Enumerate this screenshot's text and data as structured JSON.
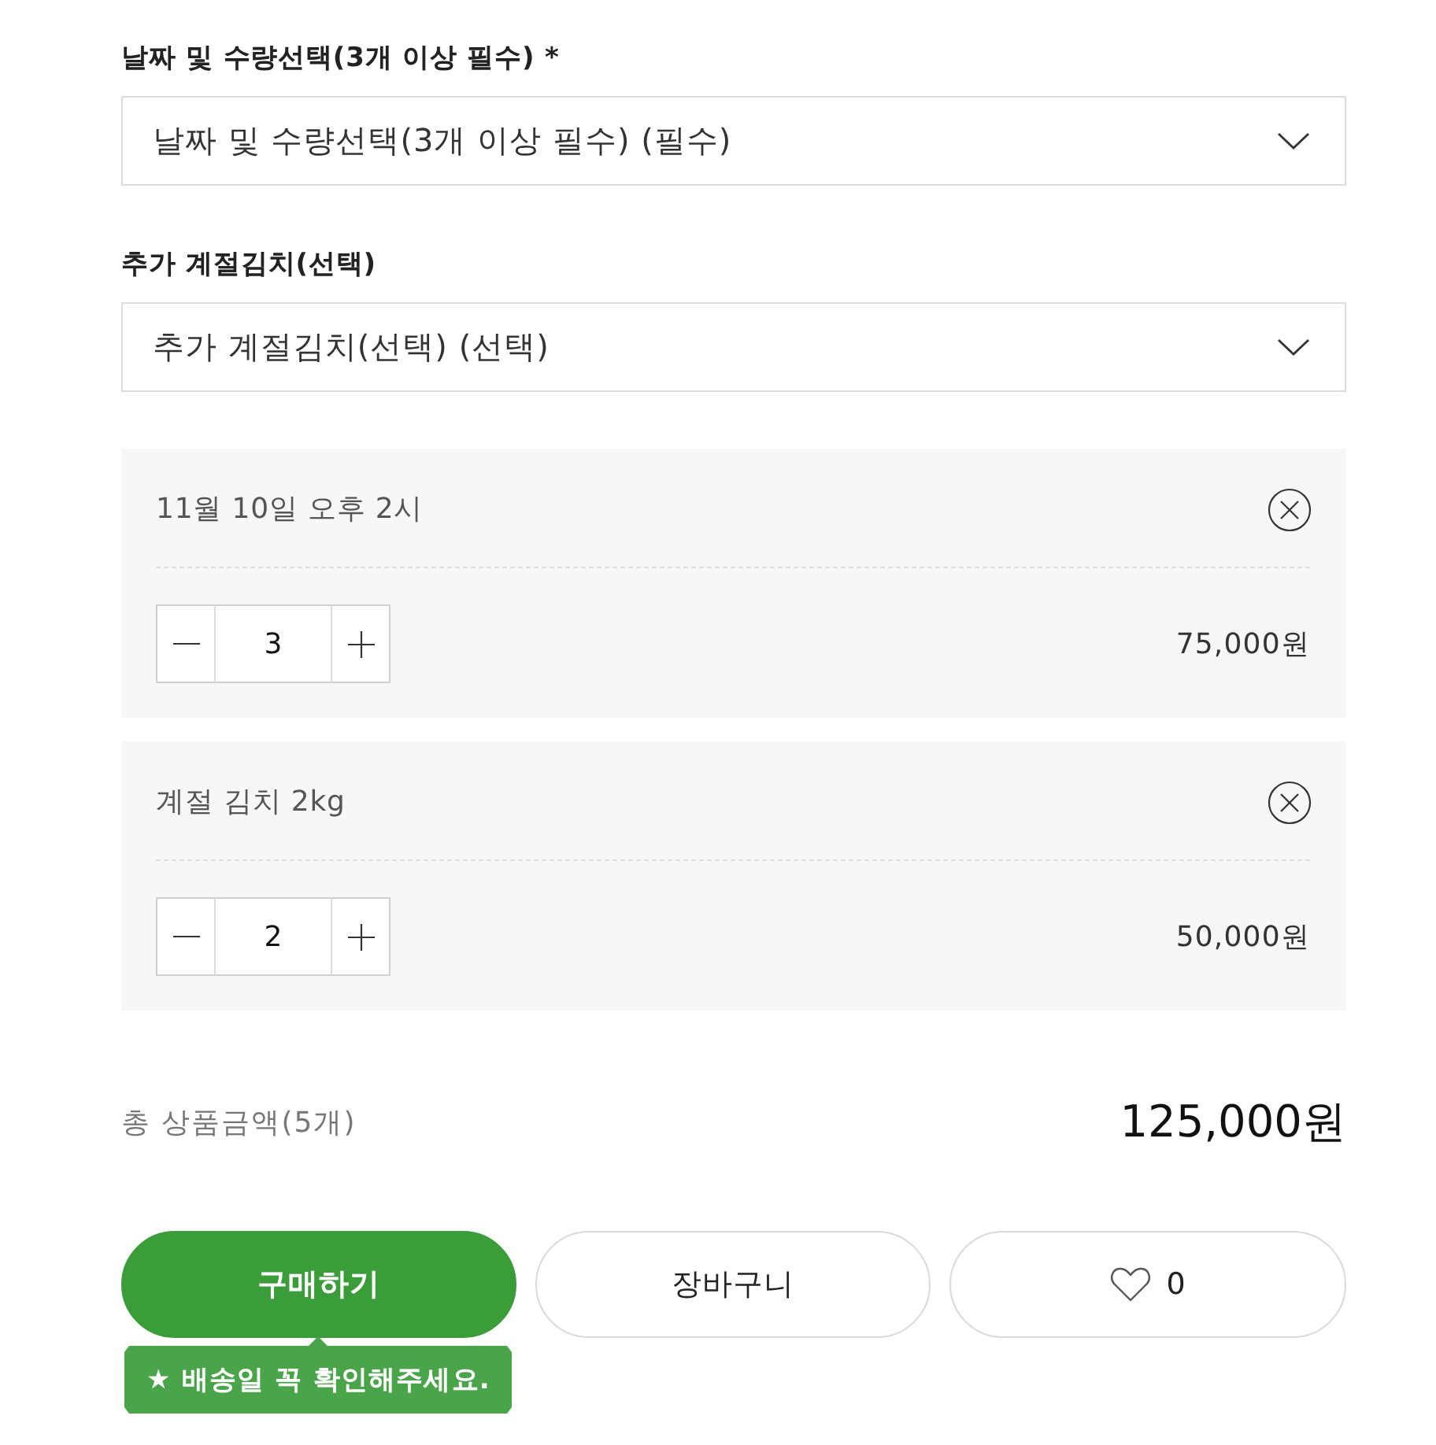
{
  "options": [
    {
      "label": "날짜 및 수량선택(3개 이상 필수) *",
      "value": "날짜 및 수량선택(3개 이상 필수) (필수)"
    },
    {
      "label": "추가 계절김치(선택)",
      "value": "추가 계절김치(선택) (선택)"
    }
  ],
  "selected_items": [
    {
      "name": "11월 10일 오후 2시",
      "quantity": "3",
      "price": "75,000원"
    },
    {
      "name": "계절 김치 2kg",
      "quantity": "2",
      "price": "50,000원"
    }
  ],
  "total": {
    "label": "총 상품금액(5개)",
    "amount": "125,000원"
  },
  "buttons": [
    {
      "kind": "buy",
      "label": "구매하기",
      "tooltip": "★ 배송일 꼭 확인해주세요."
    },
    {
      "kind": "cart",
      "label": "장바구니"
    },
    {
      "kind": "wish",
      "label": "0"
    }
  ]
}
